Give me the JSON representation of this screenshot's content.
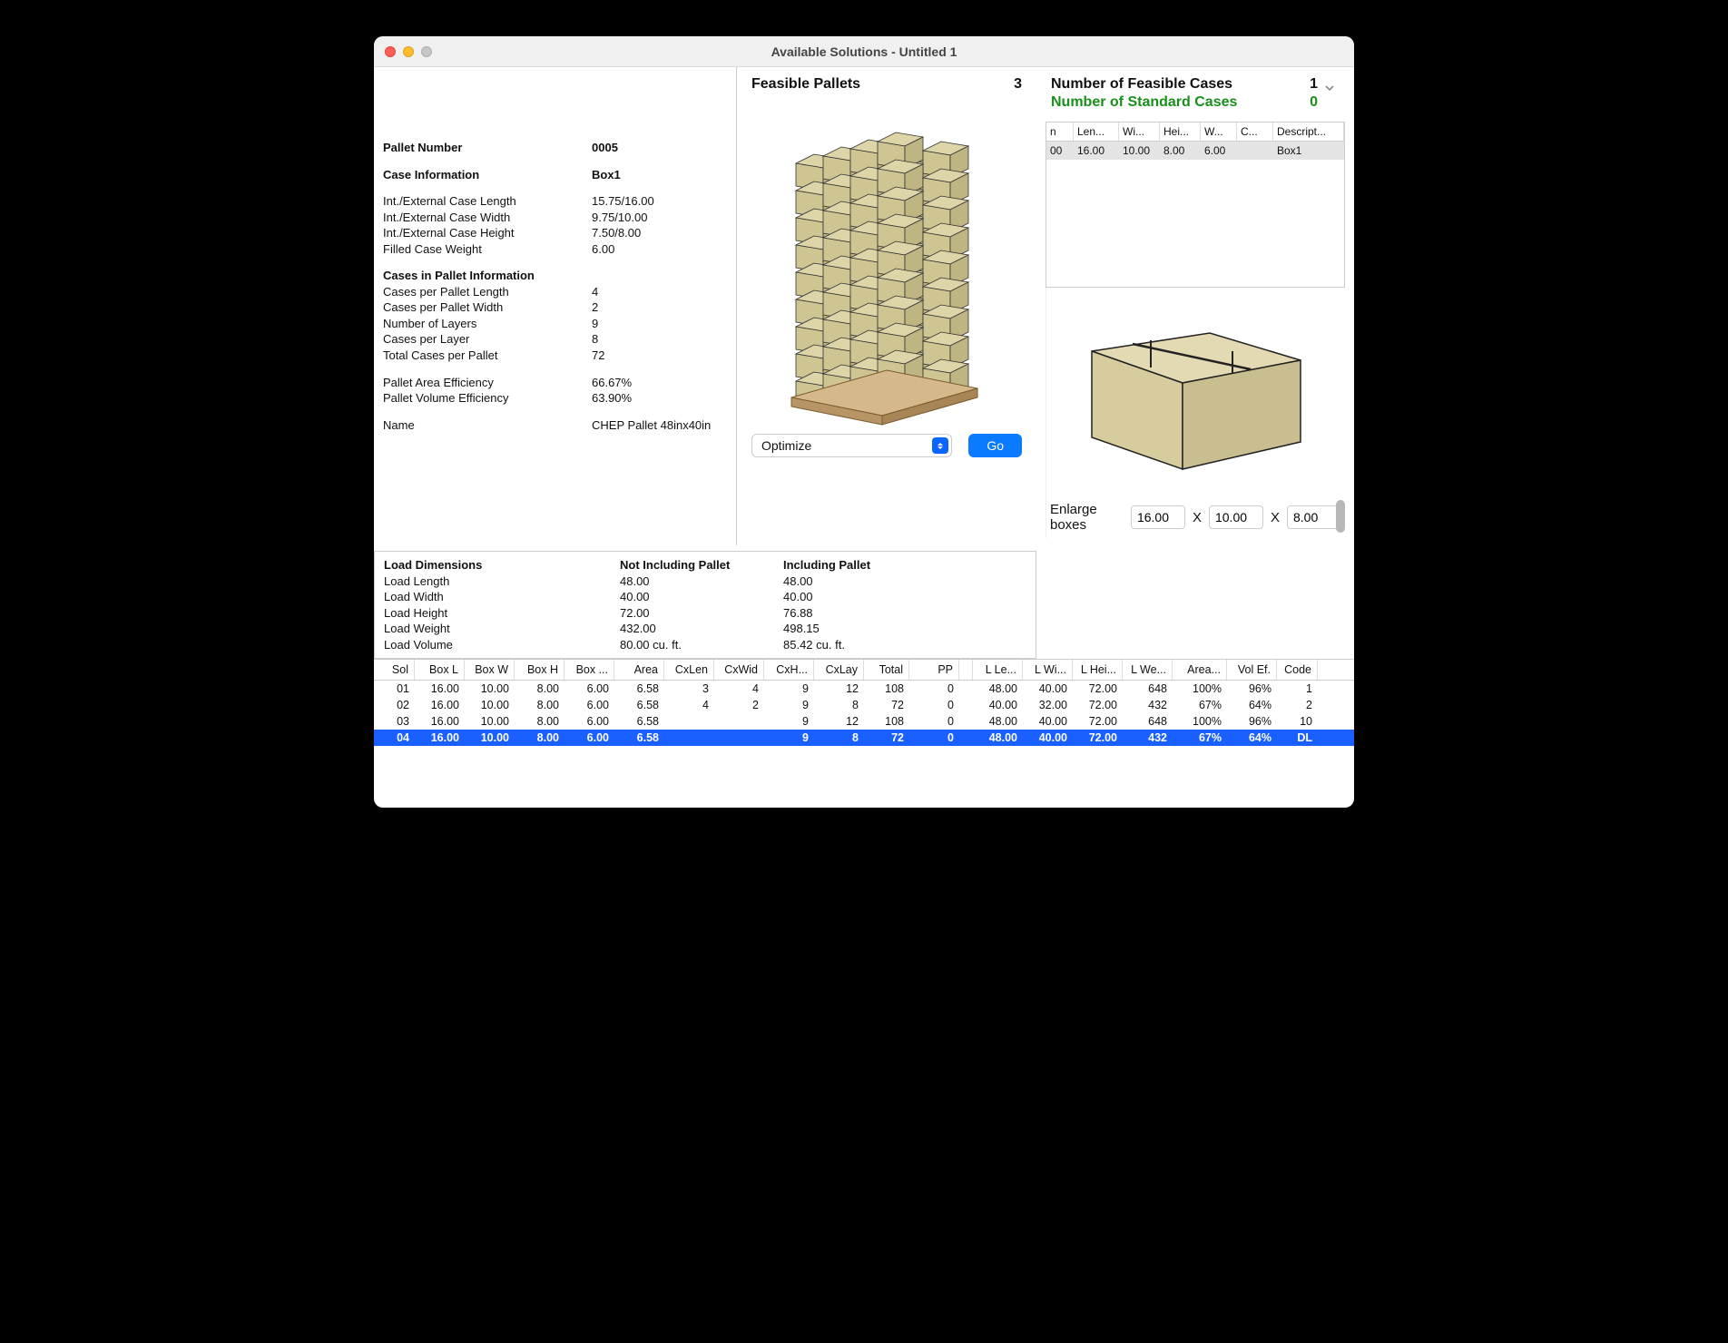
{
  "window_title": "Available Solutions - Untitled 1",
  "left": {
    "pallet_number_label": "Pallet Number",
    "pallet_number": "0005",
    "case_info_label": "Case Information",
    "case_info": "Box1",
    "rows": [
      {
        "k": "Int./External Case Length",
        "v": "15.75/16.00"
      },
      {
        "k": "Int./External Case Width",
        "v": "9.75/10.00"
      },
      {
        "k": "Int./External Case Height",
        "v": "7.50/8.00"
      },
      {
        "k": "Filled Case Weight",
        "v": "6.00"
      }
    ],
    "cases_pallet_label": "Cases in Pallet Information",
    "cprows": [
      {
        "k": "Cases per Pallet Length",
        "v": "4"
      },
      {
        "k": "Cases per Pallet Width",
        "v": "2"
      },
      {
        "k": "Number of Layers",
        "v": "9"
      },
      {
        "k": "Cases per Layer",
        "v": "8"
      },
      {
        "k": "Total Cases per Pallet",
        "v": "72"
      }
    ],
    "eff": [
      {
        "k": "Pallet Area Efficiency",
        "v": "66.67%"
      },
      {
        "k": "Pallet Volume Efficiency",
        "v": "63.90%"
      }
    ],
    "name_label": "Name",
    "name": "CHEP Pallet 48inx40in"
  },
  "mid": {
    "title": "Feasible Pallets",
    "count": "3",
    "select_value": "Optimize",
    "go_label": "Go"
  },
  "right": {
    "feasible_label": "Number of Feasible Cases",
    "feasible_count": "1",
    "standard_label": "Number of Standard Cases",
    "standard_count": "0",
    "headers": [
      "n",
      "Len...",
      "Wi...",
      "Hei...",
      "W...",
      "C...",
      "Descript..."
    ],
    "row": [
      "00",
      "16.00",
      "10.00",
      "8.00",
      "6.00",
      "",
      "Box1"
    ],
    "enlarge_label": "Enlarge boxes",
    "dim_x": "16.00",
    "dim_y": "10.00",
    "dim_z": "8.00",
    "x_sep": "X"
  },
  "load": {
    "title": "Load Dimensions",
    "col2": "Not Including Pallet",
    "col3": "Including Pallet",
    "rows": [
      {
        "k": "Load Length",
        "a": "48.00",
        "b": "48.00"
      },
      {
        "k": "Load Width",
        "a": "40.00",
        "b": "40.00"
      },
      {
        "k": "Load Height",
        "a": "72.00",
        "b": "76.88"
      },
      {
        "k": "Load Weight",
        "a": "432.00",
        "b": "498.15"
      },
      {
        "k": "Load Volume",
        "a": "80.00 cu. ft.",
        "b": "85.42 cu. ft."
      }
    ]
  },
  "solutions": {
    "headers": [
      "Sol",
      "Box L",
      "Box W",
      "Box H",
      "Box ...",
      "Area",
      "CxLen",
      "CxWid",
      "CxH...",
      "CxLay",
      "Total",
      "PP",
      "",
      "L Le...",
      "L Wi...",
      "L Hei...",
      "L We...",
      "Area...",
      "Vol Ef.",
      "Code"
    ],
    "rows": [
      [
        "01",
        "16.00",
        "10.00",
        "8.00",
        "6.00",
        "6.58",
        "3",
        "4",
        "9",
        "12",
        "108",
        "0",
        "",
        "48.00",
        "40.00",
        "72.00",
        "648",
        "100%",
        "96%",
        "1"
      ],
      [
        "02",
        "16.00",
        "10.00",
        "8.00",
        "6.00",
        "6.58",
        "4",
        "2",
        "9",
        "8",
        "72",
        "0",
        "",
        "40.00",
        "32.00",
        "72.00",
        "432",
        "67%",
        "64%",
        "2"
      ],
      [
        "03",
        "16.00",
        "10.00",
        "8.00",
        "6.00",
        "6.58",
        "",
        "",
        "9",
        "12",
        "108",
        "0",
        "",
        "48.00",
        "40.00",
        "72.00",
        "648",
        "100%",
        "96%",
        "10"
      ],
      [
        "04",
        "16.00",
        "10.00",
        "8.00",
        "6.00",
        "6.58",
        "",
        "",
        "9",
        "8",
        "72",
        "0",
        "",
        "48.00",
        "40.00",
        "72.00",
        "432",
        "67%",
        "64%",
        "DL"
      ]
    ],
    "selected": 3
  }
}
